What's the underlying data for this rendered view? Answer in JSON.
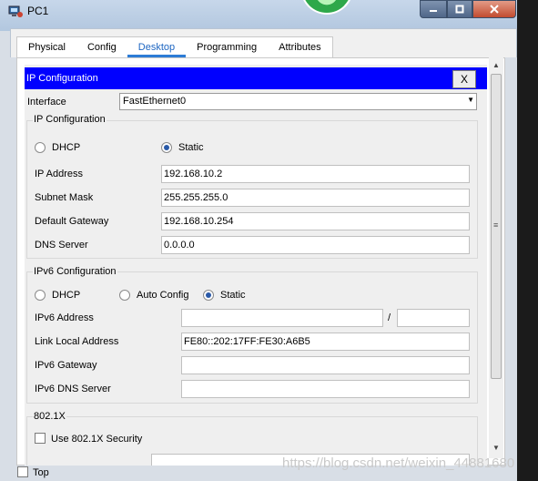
{
  "window": {
    "title": "PC1",
    "minimize_icon": "minimize-icon",
    "maximize_icon": "maximize-icon",
    "close_icon": "close-icon"
  },
  "tabs": [
    {
      "label": "Physical"
    },
    {
      "label": "Config"
    },
    {
      "label": "Desktop",
      "active": true
    },
    {
      "label": "Programming"
    },
    {
      "label": "Attributes"
    }
  ],
  "ipconfig": {
    "header": "IP Configuration",
    "close_label": "X",
    "interface_label": "Interface",
    "interface_value": "FastEthernet0",
    "ipv4_group_title": "IP Configuration",
    "dhcp_label": "DHCP",
    "static_label": "Static",
    "mode": "Static",
    "fields": [
      {
        "label": "IP Address",
        "value": "192.168.10.2"
      },
      {
        "label": "Subnet Mask",
        "value": "255.255.255.0"
      },
      {
        "label": "Default Gateway",
        "value": "192.168.10.254"
      },
      {
        "label": "DNS Server",
        "value": "0.0.0.0"
      }
    ]
  },
  "ipv6": {
    "group_title": "IPv6 Configuration",
    "dhcp_label": "DHCP",
    "auto_label": "Auto Config",
    "static_label": "Static",
    "mode": "Static",
    "address_label": "IPv6 Address",
    "address_value": "",
    "prefix_separator": "/",
    "prefix_value": "",
    "link_local_label": "Link Local Address",
    "link_local_value": "FE80::202:17FF:FE30:A6B5",
    "gateway_label": "IPv6 Gateway",
    "gateway_value": "",
    "dns_label": "IPv6 DNS Server",
    "dns_value": ""
  },
  "dot1x": {
    "group_title": "802.1X",
    "checkbox_label": "Use 802.1X Security",
    "checked": false
  },
  "bottom": {
    "top_label": "Top",
    "checked": false
  },
  "watermark": "https://blog.csdn.net/weixin_44881680",
  "colors": {
    "header_bar": "#0000ff",
    "active_tab": "#1e66c2"
  }
}
